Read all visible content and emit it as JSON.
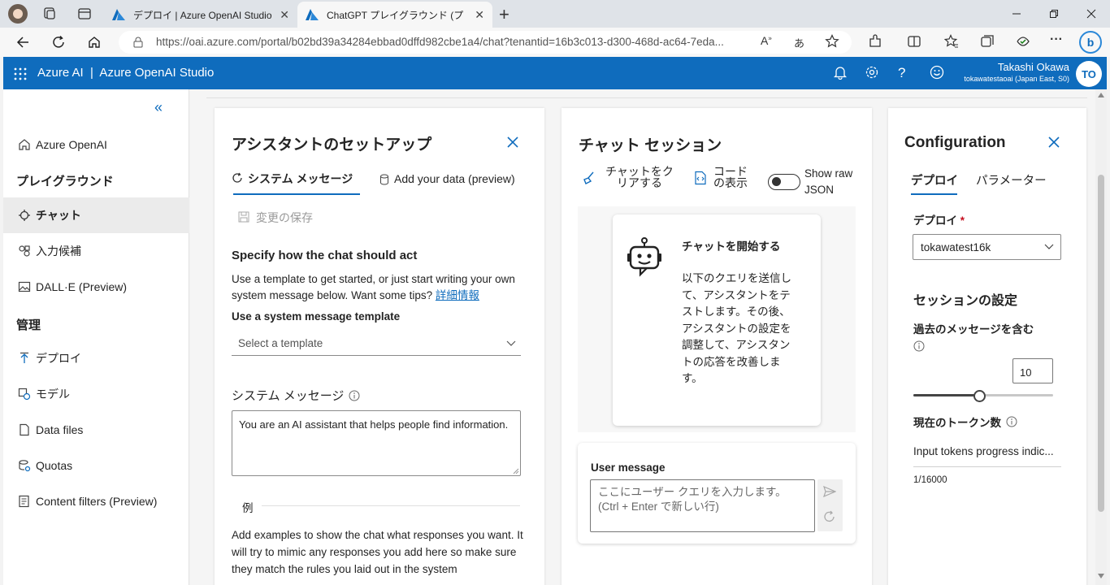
{
  "browser": {
    "tabs": [
      {
        "title": "デプロイ | Azure OpenAI Studio"
      },
      {
        "title": "ChatGPT プレイグラウンド (プレビュー)"
      }
    ],
    "url": "https://oai.azure.com/portal/b02bd39a34284ebbad0dffd982cbe1a4/chat?tenantid=16b3c013-d300-468d-ac64-7eda..."
  },
  "header": {
    "title": "Azure AI  |  Azure OpenAI Studio",
    "user_name": "Takashi Okawa",
    "user_sub": "tokawatestaoai (Japan East, S0)",
    "avatar_initials": "TO"
  },
  "sidebar": {
    "collapse": "«",
    "items": [
      {
        "label": "Azure OpenAI",
        "icon": "home-icon"
      },
      {
        "label": "プレイグラウンド",
        "heading": true
      },
      {
        "label": "チャット",
        "icon": "chat-icon",
        "active": true
      },
      {
        "label": "入力候補",
        "icon": "completions-icon"
      },
      {
        "label": "DALL·E (Preview)",
        "icon": "image-icon"
      },
      {
        "label": "管理",
        "heading": true
      },
      {
        "label": "デプロイ",
        "icon": "deploy-icon"
      },
      {
        "label": "モデル",
        "icon": "model-icon"
      },
      {
        "label": "Data files",
        "icon": "file-icon"
      },
      {
        "label": "Quotas",
        "icon": "quota-icon"
      },
      {
        "label": "Content filters (Preview)",
        "icon": "filter-icon"
      }
    ]
  },
  "setup": {
    "title": "アシスタントのセットアップ",
    "tabs": [
      "システム メッセージ",
      "Add your data (preview)"
    ],
    "save_changes": "変更の保存",
    "section_title": "Specify how the chat should act",
    "desc": "Use a template to get started, or just start writing your own system message below. Want some tips?",
    "desc_link": "詳細情報",
    "template_label": "Use a system message template",
    "template_placeholder": "Select a template",
    "system_message_label": "システム メッセージ",
    "system_message_value": "You are an AI assistant that helps people find information.",
    "examples_label": "例",
    "examples_desc": "Add examples to show the chat what responses you want. It will try to mimic any responses you add here so make sure they match the rules you laid out in the system"
  },
  "chat": {
    "title": "チャット セッション",
    "clear_chat": "チャットをクリアする",
    "view_code": "コードの表示",
    "show_raw": "Show raw JSON",
    "start_title": "チャットを開始する",
    "start_desc": "以下のクエリを送信して、アシスタントをテストします。その後、アシスタントの設定を調整して、アシスタントの応答を改善します。",
    "user_message_label": "User message",
    "user_message_placeholder": "ここにユーザー クエリを入力します。(Ctrl + Enter で新しい行)"
  },
  "config": {
    "title": "Configuration",
    "tabs": [
      "デプロイ",
      "パラメーター"
    ],
    "deploy_label": "デプロイ",
    "required_mark": "*",
    "deploy_value": "tokawatest16k",
    "session_title": "セッションの設定",
    "past_messages_label": "過去のメッセージを含む",
    "past_messages_value": "10",
    "past_messages_slider_fraction": 0.47,
    "tokens_label": "現在のトークン数",
    "tokens_progress_label": "Input tokens progress indic...",
    "tokens_count": "1/16000"
  },
  "colors": {
    "brand": "#0f6cbd",
    "header_bg": "#0f6cbd",
    "active_nav": "#ebebeb"
  }
}
